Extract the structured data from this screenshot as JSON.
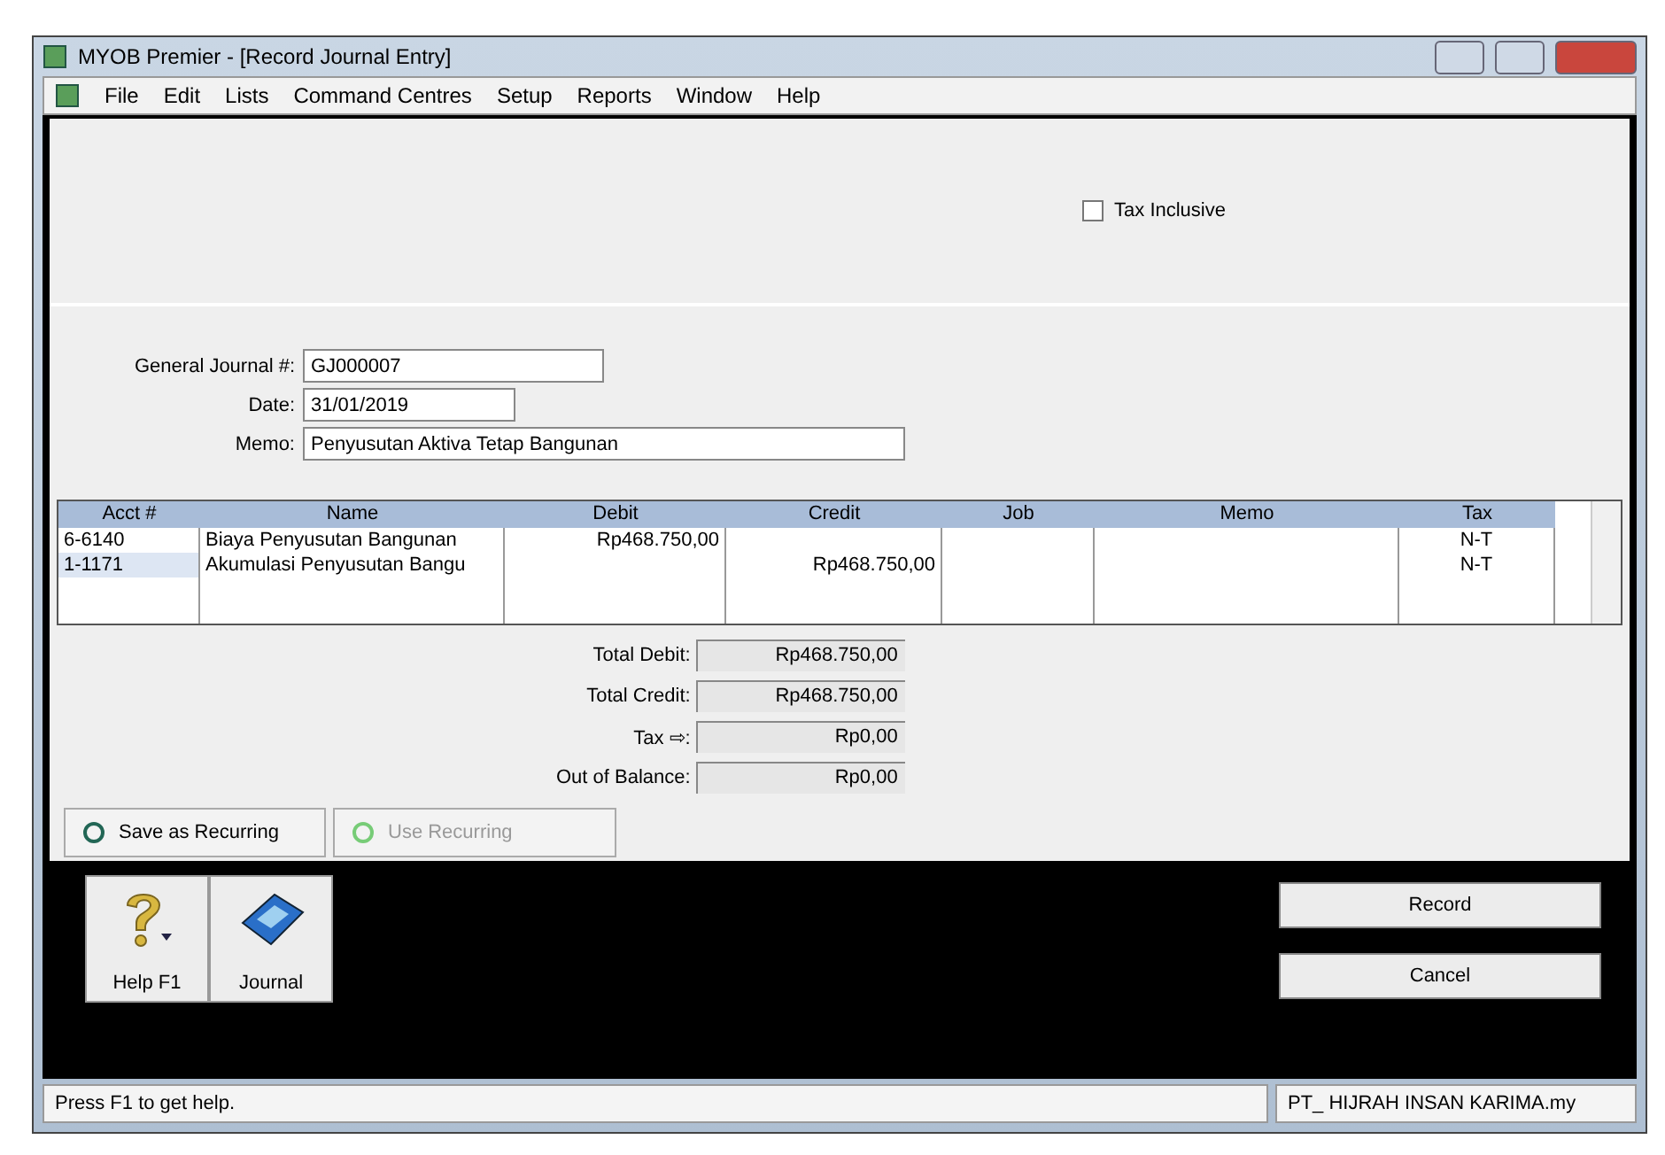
{
  "window": {
    "title": "MYOB Premier - [Record Journal Entry]"
  },
  "menu": [
    "File",
    "Edit",
    "Lists",
    "Command Centres",
    "Setup",
    "Reports",
    "Window",
    "Help"
  ],
  "tax_inclusive": {
    "label": "Tax Inclusive",
    "checked": false
  },
  "fields": [
    {
      "label": "General Journal #:",
      "value": "GJ000007"
    },
    {
      "label": "Date:",
      "value": "31/01/2019"
    },
    {
      "label": "Memo:",
      "value": "Penyusutan Aktiva Tetap Bangunan"
    }
  ],
  "table": {
    "columns": [
      "Acct #",
      "Name",
      "Debit",
      "Credit",
      "Job",
      "Memo",
      "Tax"
    ],
    "rows": [
      {
        "cells": [
          "6-6140",
          "Biaya Penyusutan Bangunan",
          "Rp468.750,00",
          "",
          "",
          "",
          "N-T"
        ],
        "selected": false
      },
      {
        "cells": [
          "1-1171",
          "Akumulasi Penyusutan Bangu",
          "",
          "Rp468.750,00",
          "",
          "",
          "N-T"
        ],
        "selected": true
      }
    ]
  },
  "totals": [
    {
      "label": "Total Debit:",
      "value": "Rp468.750,00"
    },
    {
      "label": "Total Credit:",
      "value": "Rp468.750,00"
    },
    {
      "label": "Tax ⇨:",
      "value": "Rp0,00"
    },
    {
      "label": "Out of Balance:",
      "value": "Rp0,00"
    }
  ],
  "recurring_buttons": [
    {
      "label": "Save as Recurring",
      "disabled": false
    },
    {
      "label": "Use Recurring",
      "disabled": true
    }
  ],
  "toolbar": [
    {
      "label": "Help F1",
      "kind": "help"
    },
    {
      "label": "Journal",
      "kind": "journal"
    }
  ],
  "actions": [
    "Record",
    "Cancel"
  ],
  "status_bar": {
    "message": "Press F1 to get help.",
    "company": "PT_ HIJRAH INSAN KARIMA.my"
  }
}
